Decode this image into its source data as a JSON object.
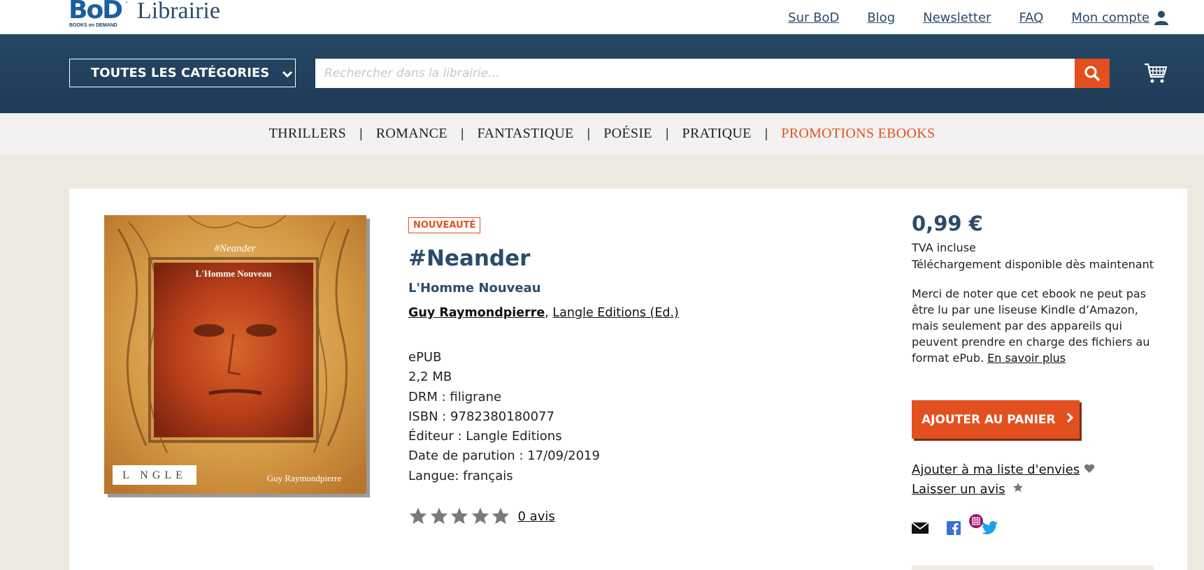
{
  "header": {
    "logo_bod": "BoD",
    "logo_bod_tm": "™",
    "logo_sub": "BOOKS on DEMAND",
    "logo_librairie": "Librairie",
    "links": [
      "Sur BoD",
      "Blog",
      "Newsletter",
      "FAQ",
      "Mon compte"
    ]
  },
  "searchbar": {
    "categories_label": "TOUTES LES CATÉGORIES",
    "placeholder": "Rechercher dans la librairie..."
  },
  "category_nav": {
    "items": [
      "THRILLERS",
      "ROMANCE",
      "FANTASTIQUE",
      "POÉSIE",
      "PRATIQUE",
      "PROMOTIONS EBOOKS"
    ],
    "separator": "|"
  },
  "product": {
    "badge": "NOUVEAUTÉ",
    "title": "#Neander",
    "subtitle": "L'Homme Nouveau",
    "author": "Guy Raymondpierre",
    "author_sep": ",",
    "publisher_link": "Langle Editions (Ed.)",
    "specs": [
      "ePUB",
      "2,2 MB",
      "DRM : filigrane",
      "ISBN : 9782380180077",
      "Éditeur : Langle Editions",
      "Date de parution : 17/09/2019",
      "Langue: français"
    ],
    "rating_stars": 0,
    "reviews_link": "0 avis",
    "cover": {
      "top_title": "#Neander",
      "inner_title": "L'Homme Nouveau",
      "publisher_logo": "L NGLE",
      "author": "Guy Raymondpierre"
    }
  },
  "purchase": {
    "price": "0,99 €",
    "vat": "TVA incluse",
    "availability": "Téléchargement disponible dès maintenant",
    "notice": "Merci de noter que cet ebook ne peut pas être lu par une liseuse Kindle d’Amazon, mais seulement par des appareils qui peuvent prendre en charge des fichiers au format ePub.",
    "notice_link": "En savoir plus",
    "add_to_cart": "AJOUTER AU PANIER",
    "wishlist": "Ajouter à ma liste d'envies",
    "review": "Laisser un avis"
  },
  "colors": {
    "accent": "#e2501f",
    "brand_blue": "#2b4b6b",
    "band": "#1e3a55"
  },
  "icons": [
    "user-icon",
    "chevron-down-icon",
    "search-icon",
    "cart-icon",
    "star-icon",
    "heart-icon",
    "mail-icon",
    "facebook-icon",
    "pinterest-icon",
    "twitter-icon"
  ]
}
